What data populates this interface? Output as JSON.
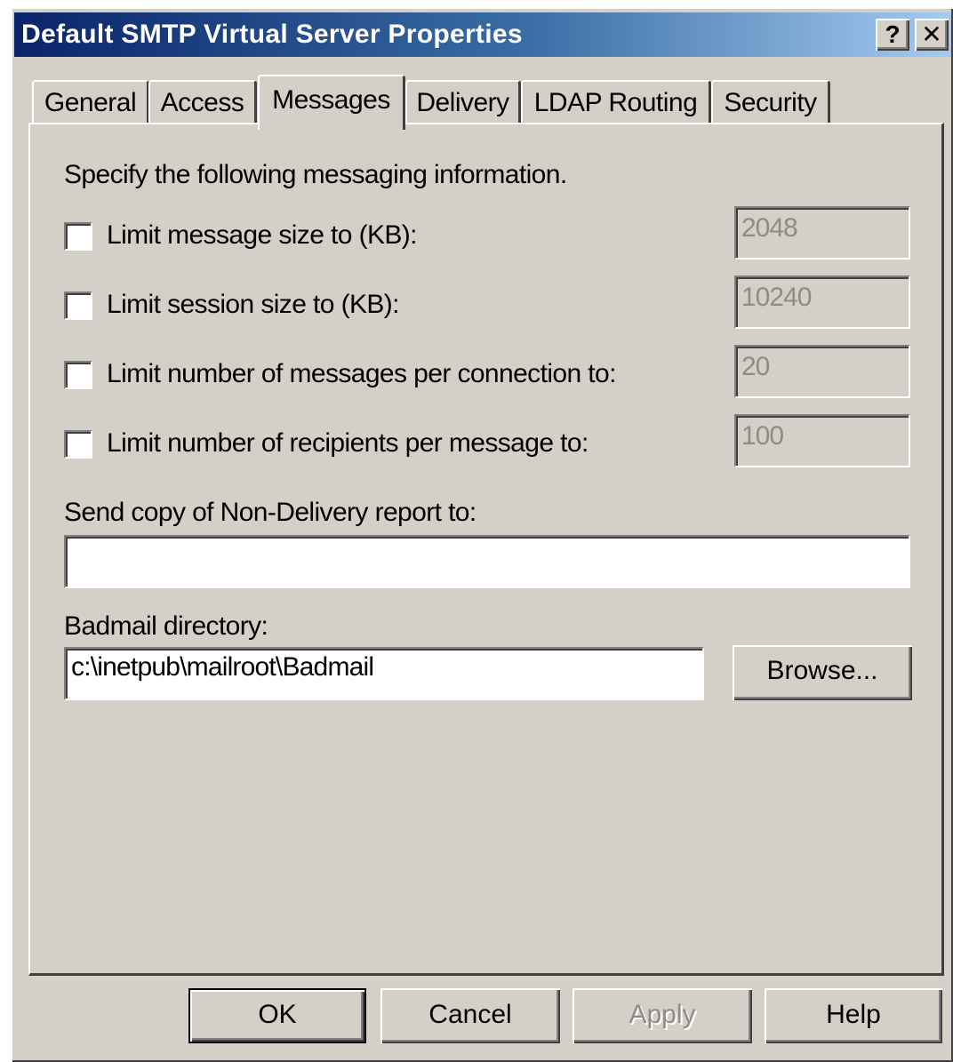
{
  "window": {
    "title": "Default SMTP Virtual Server Properties",
    "help_button": "?",
    "close_button": "✕"
  },
  "tabs": [
    {
      "label": "General",
      "active": false
    },
    {
      "label": "Access",
      "active": false
    },
    {
      "label": "Messages",
      "active": true
    },
    {
      "label": "Delivery",
      "active": false
    },
    {
      "label": "LDAP Routing",
      "active": false
    },
    {
      "label": "Security",
      "active": false
    }
  ],
  "messages": {
    "intro": "Specify the following messaging information.",
    "limits": [
      {
        "label": "Limit message size to (KB):",
        "checked": false,
        "value": "2048"
      },
      {
        "label": "Limit session size to (KB):",
        "checked": false,
        "value": "10240"
      },
      {
        "label": "Limit number of messages per connection to:",
        "checked": false,
        "value": "20"
      },
      {
        "label": "Limit number of recipients per message to:",
        "checked": false,
        "value": "100"
      }
    ],
    "ndr_label": "Send copy of Non-Delivery report to:",
    "ndr_value": "",
    "badmail_label": "Badmail directory:",
    "badmail_value": "c:\\inetpub\\mailroot\\Badmail",
    "browse_label": "Browse..."
  },
  "buttons": {
    "ok": "OK",
    "cancel": "Cancel",
    "apply": "Apply",
    "help": "Help"
  }
}
